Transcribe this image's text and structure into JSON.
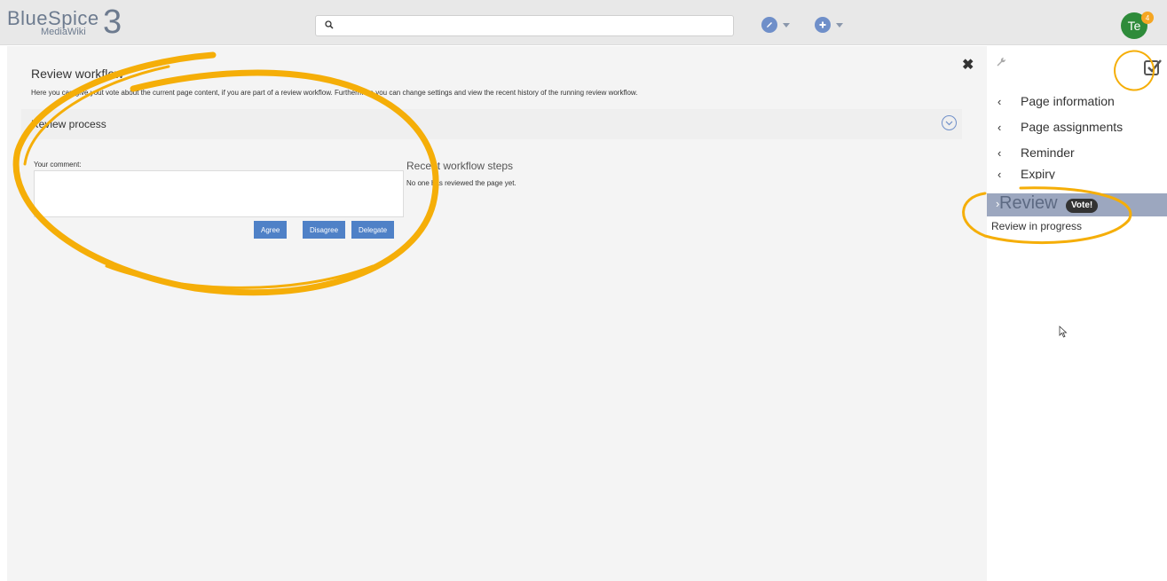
{
  "header": {
    "logo_main": "BlueSpice",
    "logo_sub": "MediaWiki",
    "logo_number": "3",
    "search_placeholder": "",
    "user_initials": "Te",
    "notification_count": "4"
  },
  "dialog": {
    "title": "Review workflow",
    "description": "Here you can give yout vote about the current page content, if you are part of a review workflow. Furthermore you can change settings and view the recent history of the running review workflow.",
    "section_label": "Review process",
    "comment_label": "Your comment:",
    "buttons": {
      "agree": "Agree",
      "disagree": "Disagree",
      "delegate": "Delegate"
    },
    "recent_steps_title": "Recent workflow steps",
    "recent_steps_empty": "No one has reviewed the page yet."
  },
  "sidebar": {
    "items": [
      {
        "label": "Page information"
      },
      {
        "label": "Page assignments"
      },
      {
        "label": "Reminder"
      },
      {
        "label": "Expiry"
      }
    ],
    "review": {
      "label": "Review",
      "badge": "Vote!",
      "status": "Review in progress"
    }
  },
  "colors": {
    "accent": "#4f81c7",
    "annotation": "#f5ae08",
    "review_row": "#9ca7bf",
    "avatar": "#2e8b3a"
  }
}
